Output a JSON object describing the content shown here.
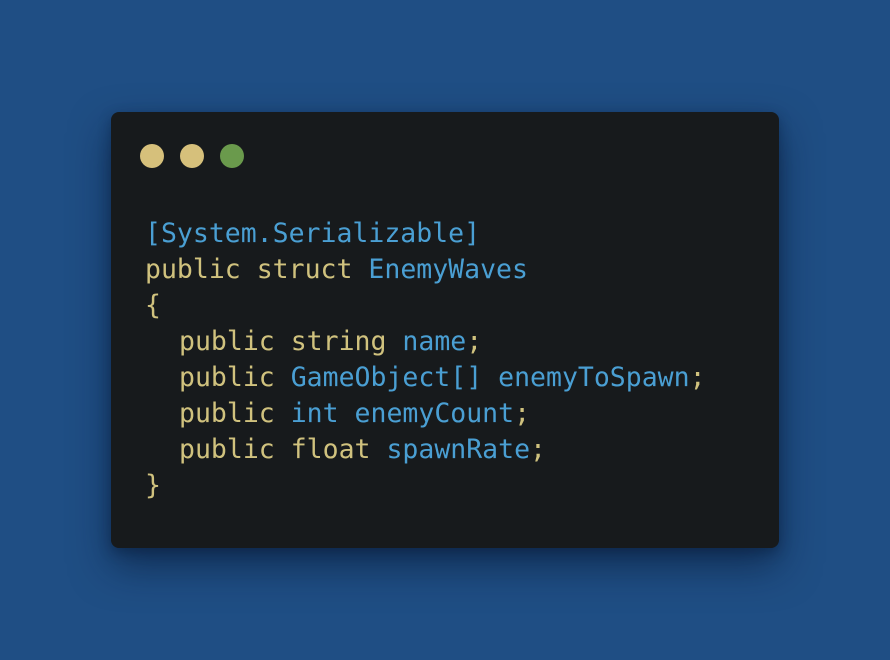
{
  "window": {
    "controls": [
      {
        "icon": "dot-icon",
        "color": "#d6c07b"
      },
      {
        "icon": "dot-icon",
        "color": "#d6c07b"
      },
      {
        "icon": "dot-icon",
        "color": "#6a9a4c"
      }
    ]
  },
  "code": {
    "attribute": "[System.Serializable]",
    "declaration": {
      "modifier": "public",
      "keyword": "struct",
      "name": "EnemyWaves"
    },
    "open_brace": "{",
    "fields": [
      {
        "modifier": "public",
        "type": "string",
        "name": "name",
        "terminator": ";"
      },
      {
        "modifier": "public",
        "type": "GameObject[]",
        "name": "enemyToSpawn",
        "terminator": ";"
      },
      {
        "modifier": "public",
        "type": "int",
        "name": "enemyCount",
        "terminator": ";"
      },
      {
        "modifier": "public",
        "type": "float",
        "name": "spawnRate",
        "terminator": ";"
      }
    ],
    "close_brace": "}"
  },
  "colors": {
    "background": "#1f4e84",
    "panel": "#171a1c",
    "keyword": "#d0c27e",
    "identifier": "#4a9fd3"
  }
}
